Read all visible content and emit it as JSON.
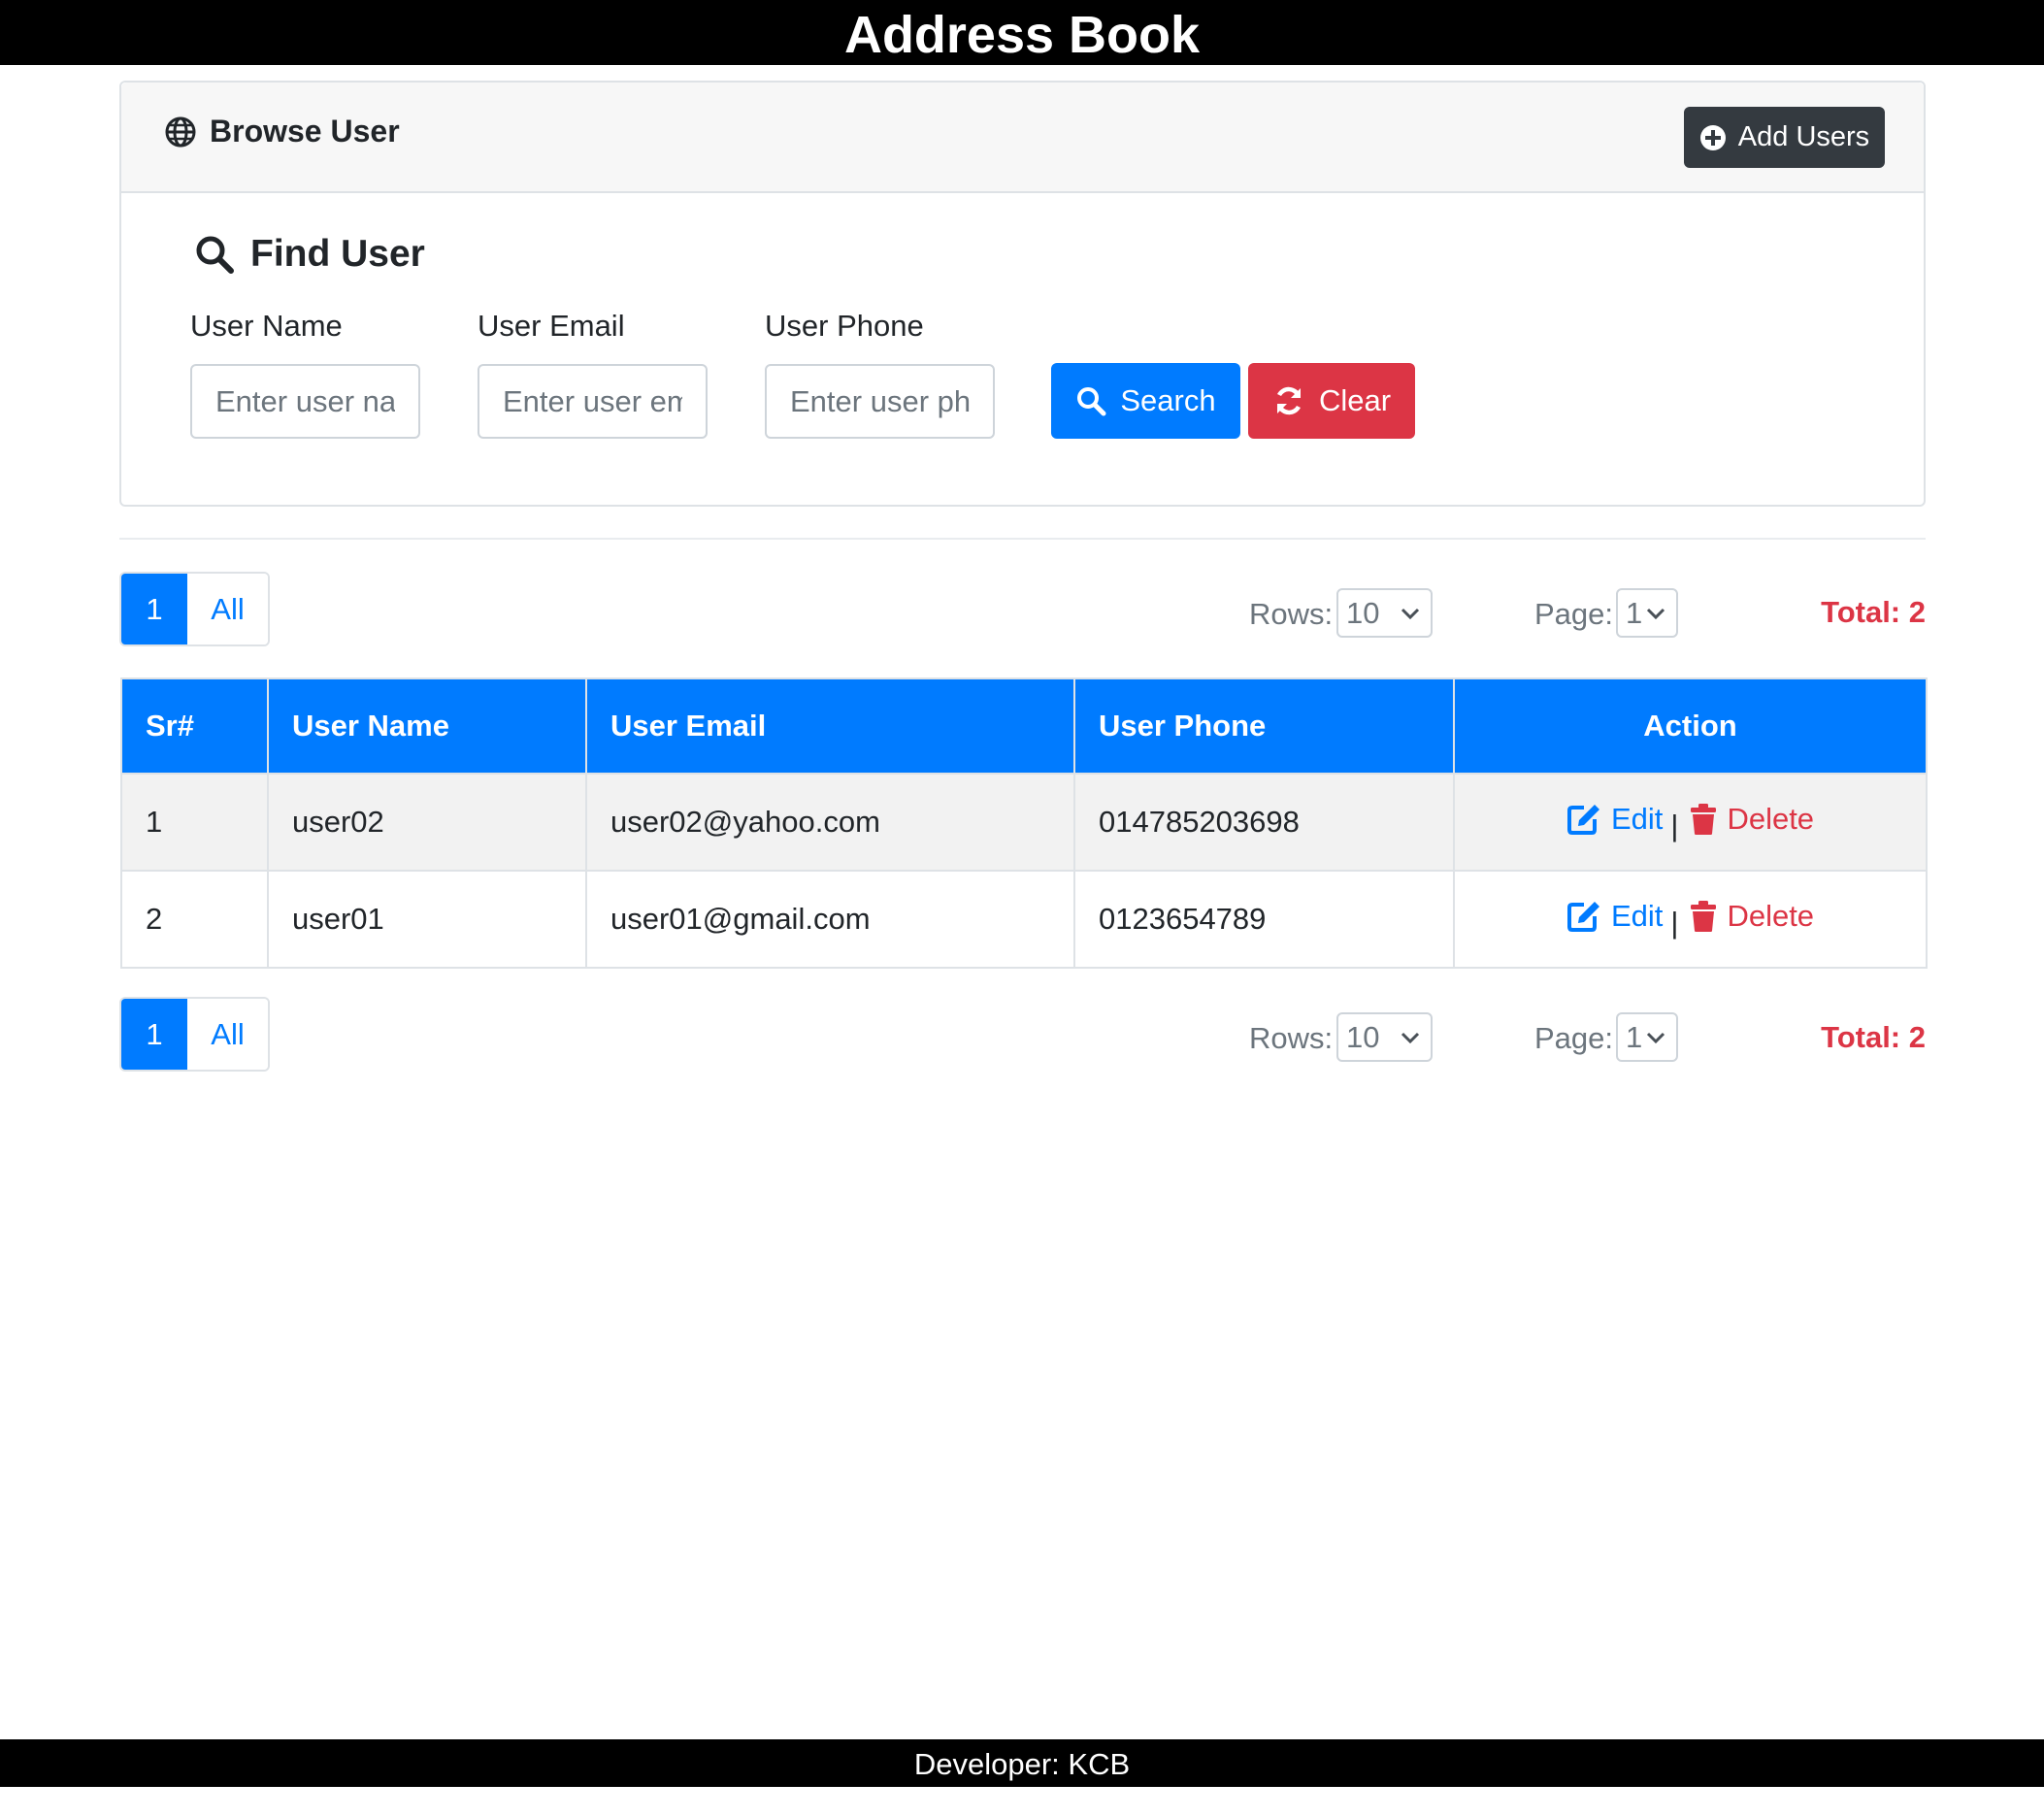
{
  "app": {
    "title": "Address Book",
    "footer": "Developer: KCB"
  },
  "card": {
    "title": "Browse User",
    "add_button": "Add Users"
  },
  "search": {
    "title": "Find User",
    "fields": [
      {
        "label": "User Name",
        "placeholder": "Enter user name"
      },
      {
        "label": "User Email",
        "placeholder": "Enter user email"
      },
      {
        "label": "User Phone",
        "placeholder": "Enter user phone"
      }
    ],
    "search_button": "Search",
    "clear_button": "Clear"
  },
  "pagination": {
    "pages": [
      "1",
      "All"
    ],
    "rows_label": "Rows:",
    "rows_value": "10",
    "page_label": "Page:",
    "page_value": "1",
    "total": "Total: 2"
  },
  "table": {
    "headers": [
      "Sr#",
      "User Name",
      "User Email",
      "User Phone",
      "Action"
    ],
    "rows": [
      {
        "sr": "1",
        "name": "user02",
        "email": "user02@yahoo.com",
        "phone": "014785203698"
      },
      {
        "sr": "2",
        "name": "user01",
        "email": "user01@gmail.com",
        "phone": "0123654789"
      }
    ],
    "edit_label": "Edit",
    "separator": "|",
    "delete_label": "Delete"
  },
  "colors": {
    "primary": "#007bff",
    "danger": "#dc3545",
    "dark": "#343a40",
    "header_bar": "#000000"
  },
  "icons": [
    "globe-icon",
    "plus-circle-icon",
    "search-icon",
    "refresh-icon",
    "edit-icon",
    "trash-icon",
    "chevron-down-icon"
  ]
}
